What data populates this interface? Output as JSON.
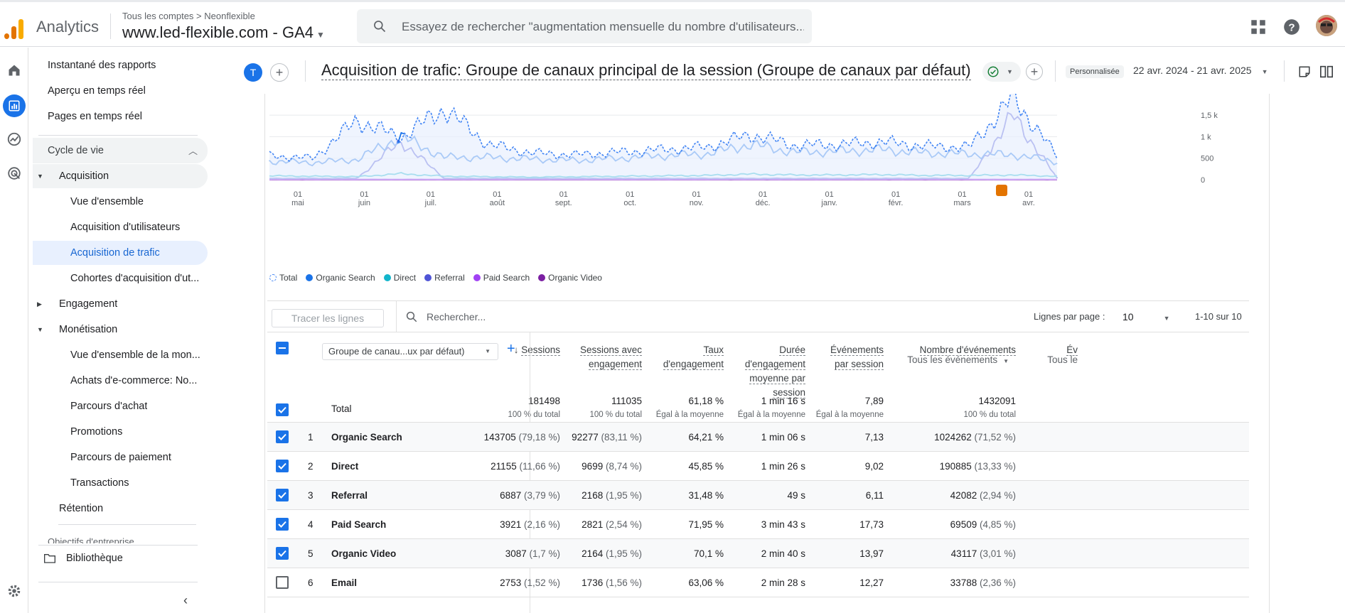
{
  "app": {
    "name": "Analytics",
    "breadcrumb": "Tous les comptes > Neonflexible",
    "property": "www.led-flexible.com  - GA4",
    "search_placeholder": "Essayez de rechercher \"augmentation mensuelle du nombre d'utilisateurs..."
  },
  "sidebar": {
    "top_items": [
      "Instantané des rapports",
      "Aperçu en temps réel",
      "Pages en temps réel"
    ],
    "section": "Cycle de vie",
    "acquisition": "Acquisition",
    "acq_items": [
      "Vue d'ensemble",
      "Acquisition d'utilisateurs",
      "Acquisition de trafic",
      "Cohortes d'acquisition d'ut..."
    ],
    "engagement": "Engagement",
    "monetisation": "Monétisation",
    "mon_items": [
      "Vue d'ensemble de la mon...",
      "Achats d'e-commerce: No...",
      "Parcours d'achat",
      "Promotions",
      "Parcours de paiement",
      "Transactions"
    ],
    "retention": "Rétention",
    "partial": "Objectifs d'entreprise",
    "library": "Bibliothèque"
  },
  "header": {
    "avatar_letter": "T",
    "title": "Acquisition de trafic: Groupe de canaux principal de la session (Groupe de canaux par défaut)",
    "custom_chip": "Personnalisée",
    "date_range": "22 avr. 2024 - 21 avr. 2025"
  },
  "chart_data": {
    "type": "line",
    "y_ticks": [
      "1,5 k",
      "1 k",
      "500",
      "0"
    ],
    "ylim": [
      0,
      1800
    ],
    "x_ticks": [
      {
        "d": "01",
        "m": "mai"
      },
      {
        "d": "01",
        "m": "juin"
      },
      {
        "d": "01",
        "m": "juil."
      },
      {
        "d": "01",
        "m": "août"
      },
      {
        "d": "01",
        "m": "sept."
      },
      {
        "d": "01",
        "m": "oct."
      },
      {
        "d": "01",
        "m": "nov."
      },
      {
        "d": "01",
        "m": "déc."
      },
      {
        "d": "01",
        "m": "janv."
      },
      {
        "d": "01",
        "m": "févr."
      },
      {
        "d": "01",
        "m": "mars"
      },
      {
        "d": "01",
        "m": "avr."
      }
    ],
    "series": [
      {
        "name": "Total",
        "color": "#4285f4",
        "values": [
          560,
          500,
          1380,
          980,
          1650,
          820,
          620,
          580,
          640,
          700,
          760,
          1050,
          800,
          820,
          880,
          780,
          760,
          1920,
          540
        ]
      },
      {
        "name": "Organic Search",
        "color": "#1a73e8",
        "values": [
          430,
          400,
          470,
          1000,
          520,
          520,
          480,
          450,
          500,
          560,
          600,
          820,
          640,
          660,
          700,
          620,
          600,
          580,
          420
        ]
      },
      {
        "name": "Direct",
        "color": "#12b5cb",
        "values": [
          90,
          80,
          70,
          140,
          80,
          70,
          60,
          70,
          80,
          90,
          100,
          130,
          110,
          110,
          120,
          100,
          100,
          110,
          80
        ]
      },
      {
        "name": "Referral",
        "color": "#4f54d6",
        "values": [
          30,
          30,
          30,
          900,
          30,
          30,
          30,
          30,
          30,
          30,
          30,
          30,
          30,
          30,
          30,
          30,
          30,
          1500,
          30
        ]
      },
      {
        "name": "Paid Search",
        "color": "#a142f4",
        "values": [
          10,
          10,
          10,
          10,
          10,
          10,
          10,
          10,
          10,
          10,
          10,
          10,
          10,
          10,
          10,
          10,
          10,
          10,
          10
        ]
      },
      {
        "name": "Organic Video",
        "color": "#7b1fa2",
        "values": [
          5,
          5,
          5,
          5,
          5,
          5,
          5,
          5,
          5,
          5,
          5,
          5,
          5,
          5,
          5,
          5,
          5,
          5,
          5
        ]
      }
    ]
  },
  "toolbar": {
    "trace_label": "Tracer les lignes",
    "search_placeholder": "Rechercher...",
    "rows_label": "Lignes par page :",
    "rows_value": "10",
    "pager": "1-10 sur 10"
  },
  "table": {
    "dimension": "Groupe de canau...ux par défaut)",
    "columns": [
      {
        "label_lines": [
          "Sessions"
        ],
        "sorted": true
      },
      {
        "label_lines": [
          "Sessions avec",
          "engagement"
        ]
      },
      {
        "label_lines": [
          "Taux",
          "d'engagement"
        ]
      },
      {
        "label_lines": [
          "Durée",
          "d'engagement",
          "moyenne par",
          "session"
        ]
      },
      {
        "label_lines": [
          "Événements",
          "par session"
        ]
      },
      {
        "label_lines": [
          "Nombre d'événements"
        ],
        "sub": "Tous les événements"
      },
      {
        "label_lines": [
          "Év"
        ],
        "sub": "Tous le"
      }
    ],
    "total_label": "Total",
    "totals": [
      {
        "v": "181498",
        "s": "100 % du total"
      },
      {
        "v": "111035",
        "s": "100 % du total"
      },
      {
        "v": "61,18 %",
        "s": "Égal à la moyenne"
      },
      {
        "v": "1 min 16 s",
        "s": "Égal à la moyenne"
      },
      {
        "v": "7,89",
        "s": "Égal à la moyenne"
      },
      {
        "v": "1432091",
        "s": "100 % du total"
      }
    ],
    "rows": [
      {
        "rank": "1",
        "name": "Organic Search",
        "checked": true,
        "cells": [
          [
            "143705",
            " (79,18 %)"
          ],
          [
            "92277",
            " (83,11 %)"
          ],
          [
            "64,21 %",
            ""
          ],
          [
            "1 min 06 s",
            ""
          ],
          [
            "7,13",
            ""
          ],
          [
            "1024262",
            " (71,52 %)"
          ]
        ]
      },
      {
        "rank": "2",
        "name": "Direct",
        "checked": true,
        "cells": [
          [
            "21155",
            " (11,66 %)"
          ],
          [
            "9699",
            " (8,74 %)"
          ],
          [
            "45,85 %",
            ""
          ],
          [
            "1 min 26 s",
            ""
          ],
          [
            "9,02",
            ""
          ],
          [
            "190885",
            " (13,33 %)"
          ]
        ]
      },
      {
        "rank": "3",
        "name": "Referral",
        "checked": true,
        "cells": [
          [
            "6887",
            " (3,79 %)"
          ],
          [
            "2168",
            " (1,95 %)"
          ],
          [
            "31,48 %",
            ""
          ],
          [
            "49 s",
            ""
          ],
          [
            "6,11",
            ""
          ],
          [
            "42082",
            " (2,94 %)"
          ]
        ]
      },
      {
        "rank": "4",
        "name": "Paid Search",
        "checked": true,
        "cells": [
          [
            "3921",
            " (2,16 %)"
          ],
          [
            "2821",
            " (2,54 %)"
          ],
          [
            "71,95 %",
            ""
          ],
          [
            "3 min 43 s",
            ""
          ],
          [
            "17,73",
            ""
          ],
          [
            "69509",
            " (4,85 %)"
          ]
        ]
      },
      {
        "rank": "5",
        "name": "Organic Video",
        "checked": true,
        "cells": [
          [
            "3087",
            " (1,7 %)"
          ],
          [
            "2164",
            " (1,95 %)"
          ],
          [
            "70,1 %",
            ""
          ],
          [
            "2 min 40 s",
            ""
          ],
          [
            "13,97",
            ""
          ],
          [
            "43117",
            " (3,01 %)"
          ]
        ]
      },
      {
        "rank": "6",
        "name": "Email",
        "checked": false,
        "cells": [
          [
            "2753",
            " (1,52 %)"
          ],
          [
            "1736",
            " (1,56 %)"
          ],
          [
            "63,06 %",
            ""
          ],
          [
            "2 min 28 s",
            ""
          ],
          [
            "12,27",
            ""
          ],
          [
            "33788",
            " (2,36 %)"
          ]
        ]
      }
    ]
  }
}
